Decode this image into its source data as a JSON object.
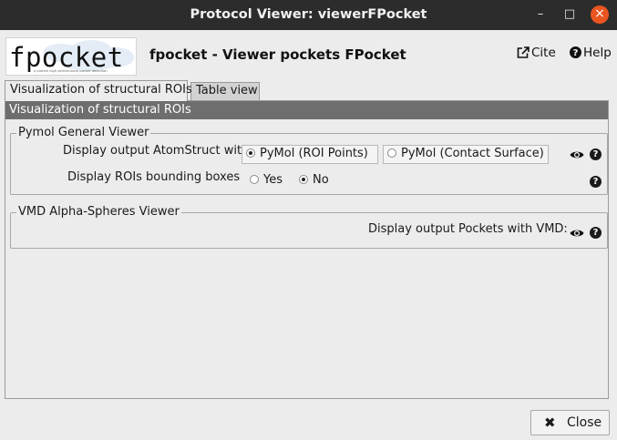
{
  "window": {
    "title": "Protocol Viewer: viewerFPocket"
  },
  "logo": {
    "text": "fpocket",
    "tagline": "a protein high performance pocket detection"
  },
  "header": {
    "title": "fpocket - Viewer pockets FPocket",
    "cite_label": "Cite",
    "help_label": "Help"
  },
  "tabs": [
    {
      "label": "Visualization of structural ROIs",
      "active": true
    },
    {
      "label": "Table view",
      "active": false
    }
  ],
  "section": {
    "title": "Visualization of structural ROIs"
  },
  "pymol_group": {
    "legend": "Pymol General Viewer",
    "atomstruct_label": "Display output AtomStruct with",
    "options": [
      {
        "label": "PyMol (ROI Points)",
        "selected": true
      },
      {
        "label": "PyMol (Contact Surface)",
        "selected": false
      }
    ],
    "bbox_label": "Display ROIs bounding boxes",
    "bbox_options": [
      {
        "label": "Yes",
        "selected": false
      },
      {
        "label": "No",
        "selected": true
      }
    ]
  },
  "vmd_group": {
    "legend": "VMD Alpha-Spheres Viewer",
    "pockets_label": "Display output Pockets with VMD:"
  },
  "footer": {
    "close_label": "Close"
  },
  "icons": {
    "help": "question-circle-icon",
    "view": "eye-icon",
    "cite": "external-link-icon"
  }
}
